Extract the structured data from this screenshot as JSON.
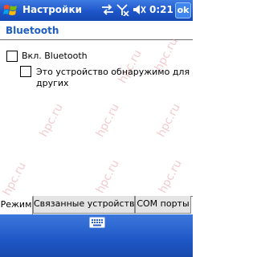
{
  "titlebar": {
    "title": "Настройки",
    "clock": "0:21",
    "ok_label": "ok",
    "icons": [
      "windows-start-icon",
      "connectivity-icon",
      "no-signal-icon",
      "speaker-icon"
    ]
  },
  "page": {
    "title": "Bluetooth"
  },
  "options": {
    "bluetooth_on_label": "Вкл. Bluetooth",
    "bluetooth_on_checked": false,
    "discoverable_line1": "Это устройство обнаружимо для",
    "discoverable_line2": "других",
    "discoverable_checked": false
  },
  "watermark_text": "hpc.ru",
  "tabs": [
    {
      "label": "Режим",
      "active": true
    },
    {
      "label": "Связанные устройства",
      "active": false
    },
    {
      "label": "COM порты",
      "active": false
    }
  ],
  "menubar": {
    "icons": [
      "keyboard-icon"
    ]
  },
  "colors": {
    "titlebar_blue": "#1d55c8",
    "page_title_blue": "#1e5ebd",
    "watermark_pink": "#e6a1a6"
  }
}
